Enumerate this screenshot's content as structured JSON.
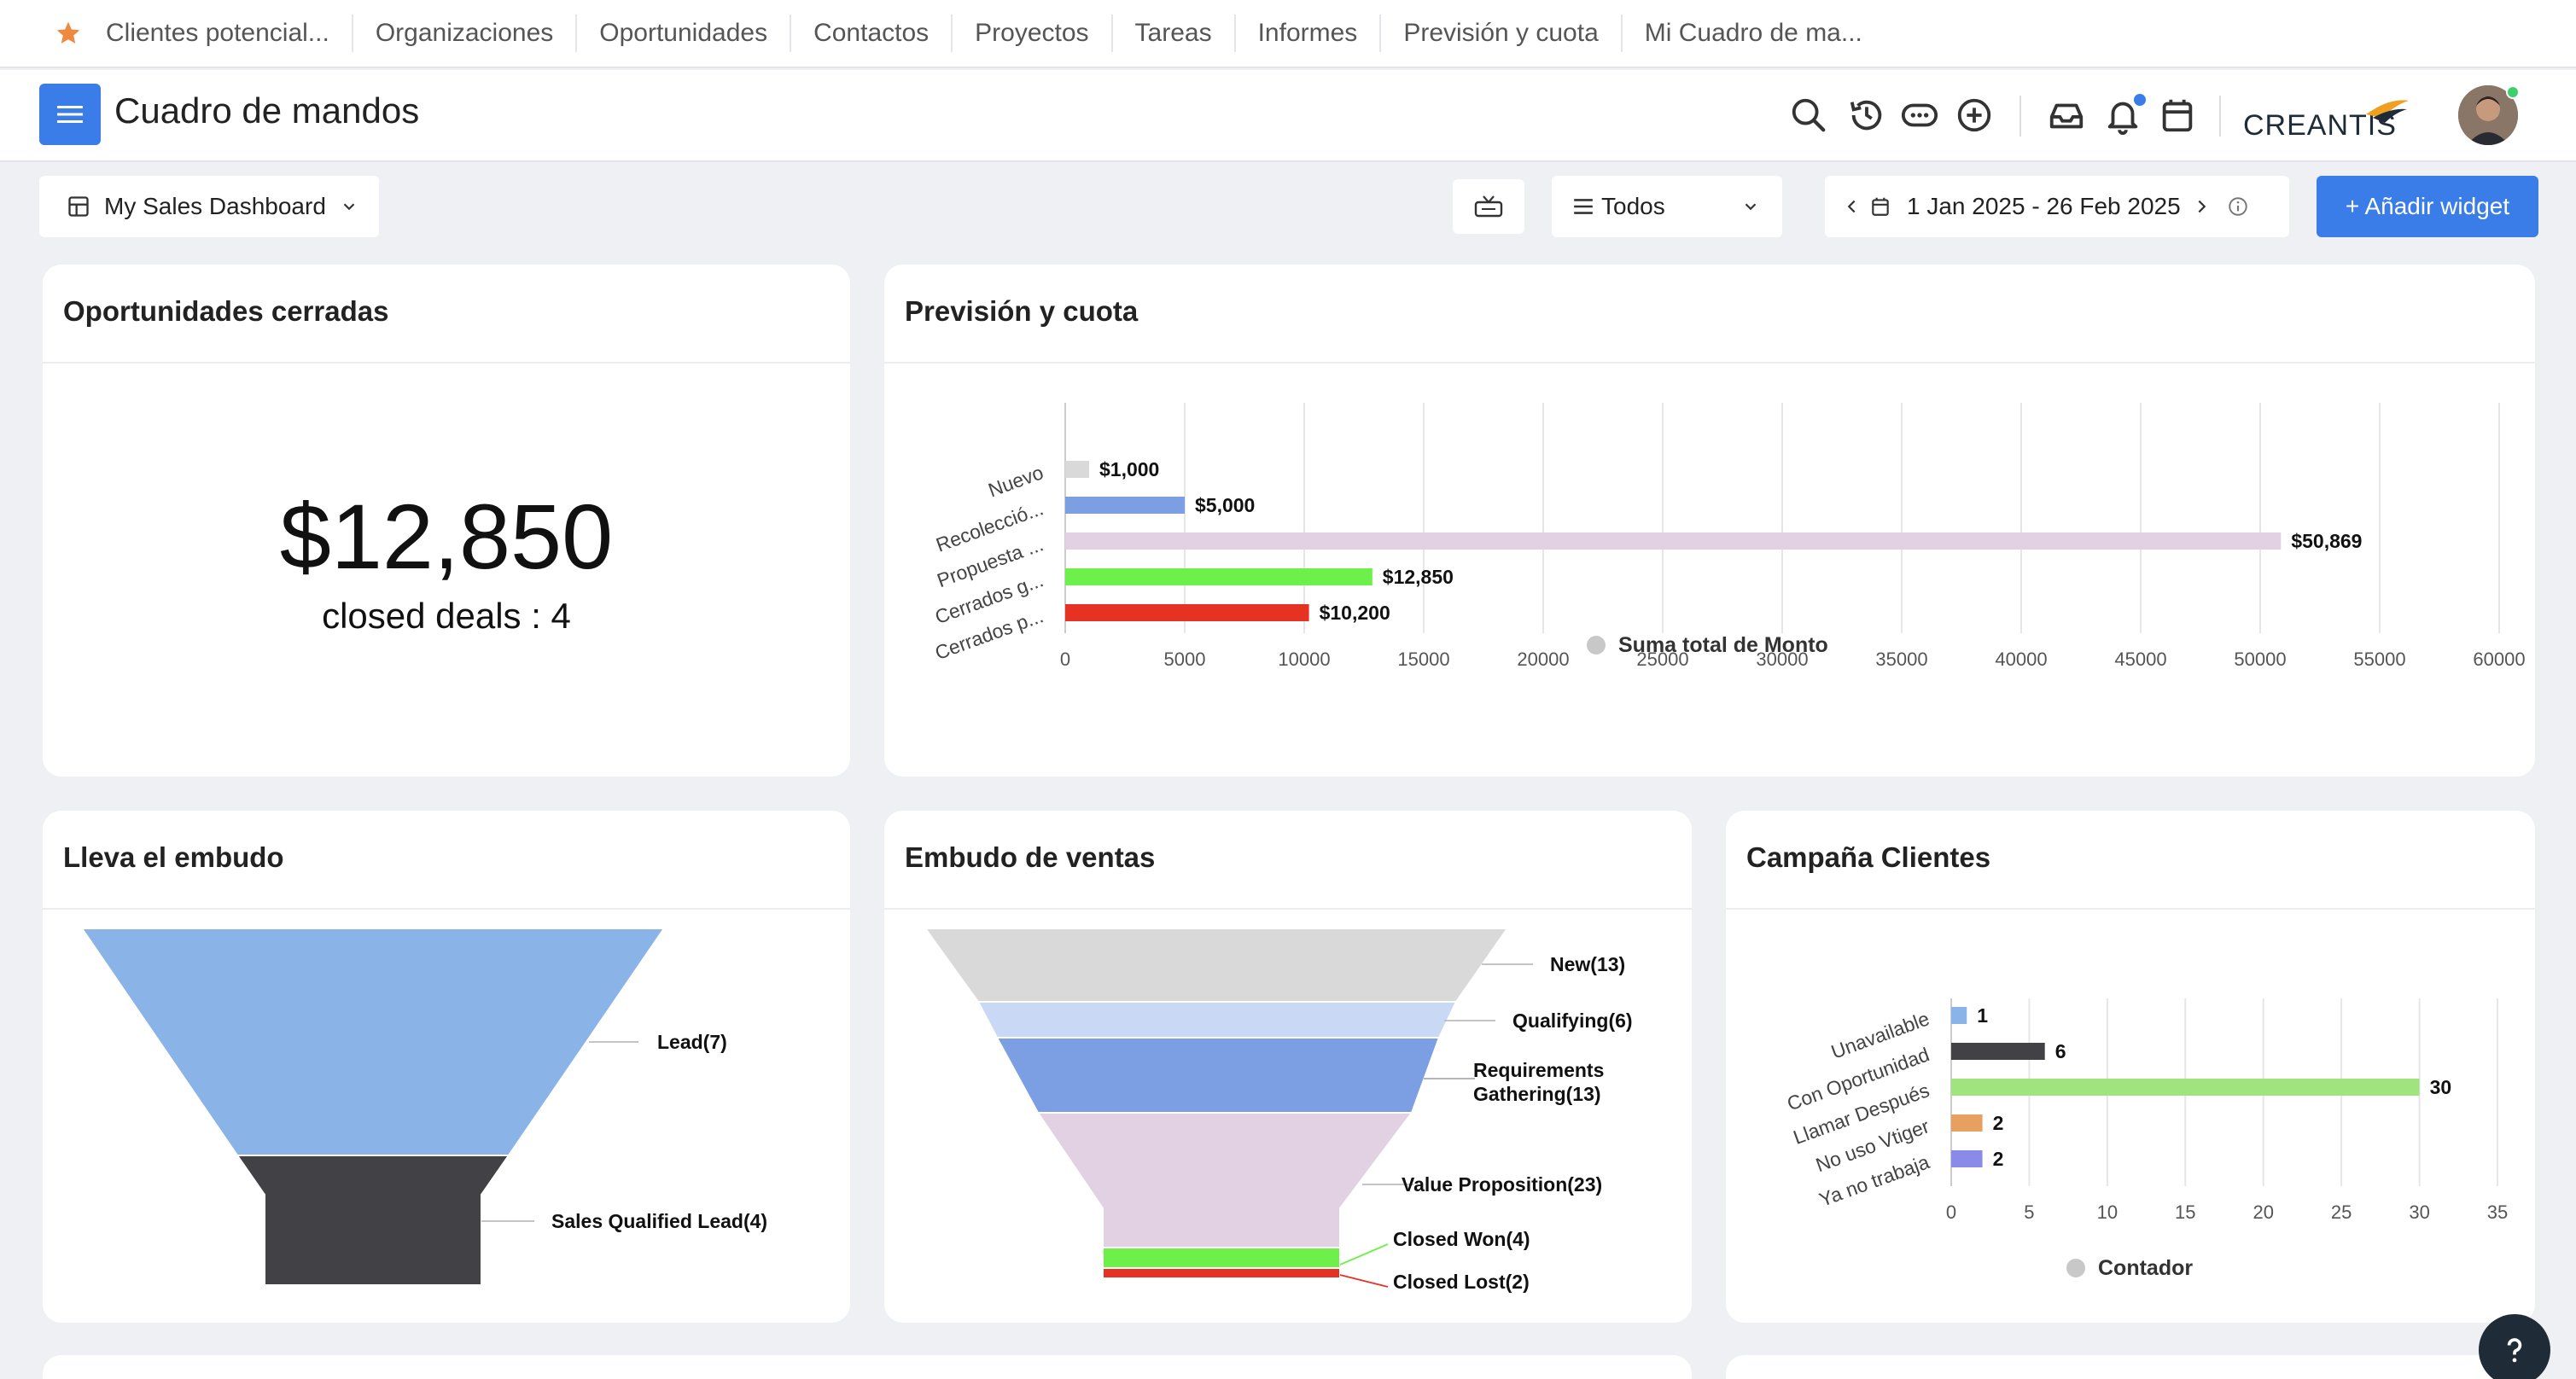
{
  "nav": {
    "tabs": [
      "Clientes potencial...",
      "Organizaciones",
      "Oportunidades",
      "Contactos",
      "Proyectos",
      "Tareas",
      "Informes",
      "Previsión y cuota",
      "Mi Cuadro de ma..."
    ]
  },
  "header": {
    "title": "Cuadro de mandos",
    "logo_text": "CREANTIS",
    "icons": [
      "search-icon",
      "history-icon",
      "chat-icon",
      "add-circle-icon",
      "inbox-icon",
      "bell-icon",
      "calendar-icon"
    ]
  },
  "toolbar": {
    "dashboard_select": "My Sales Dashboard",
    "filter_select": "Todos",
    "date_range": "1 Jan 2025 - 26 Feb 2025",
    "add_widget": "+ Añadir widget"
  },
  "widgets": {
    "closed": {
      "title": "Oportunidades cerradas",
      "value": "$12,850",
      "subtitle": "closed deals : 4"
    },
    "forecast": {
      "title": "Previsión y cuota"
    },
    "leads_funnel": {
      "title": "Lleva el embudo"
    },
    "sales_funnel": {
      "title": "Embudo de ventas"
    },
    "campaign": {
      "title": "Campaña Clientes"
    }
  },
  "colors": {
    "accent": "#3b7de8",
    "gray_bar": "#d9d9d9",
    "blue_bar": "#7b9fe2",
    "pink_bar": "#e2d1e2",
    "green_bar": "#6ef04a",
    "red_bar": "#e53222"
  },
  "chart_data": [
    {
      "type": "bar",
      "orientation": "horizontal",
      "categories": [
        "Nuevo",
        "Recolecció...",
        "Propuesta ...",
        "Cerrados g...",
        "Cerrados p..."
      ],
      "series": [
        {
          "name": "Suma total de Monto",
          "values": [
            1000,
            5000,
            50869,
            12850,
            10200
          ]
        }
      ],
      "data_labels": [
        "$1,000",
        "$5,000",
        "$50,869",
        "$12,850",
        "$10,200"
      ],
      "bar_colors": [
        "#d9d9d9",
        "#7b9fe2",
        "#e2d1e2",
        "#6ef04a",
        "#e53222"
      ],
      "x_ticks": [
        "0",
        "5000",
        "10000",
        "15000",
        "20000",
        "25000",
        "30000",
        "35000",
        "40000",
        "45000",
        "50000",
        "55000",
        "60000"
      ],
      "xlim": [
        0,
        60000
      ],
      "legend": "bottom",
      "grid": true
    },
    {
      "type": "funnel",
      "stages": [
        {
          "label": "Lead(7)",
          "value": 7,
          "color": "#8ab4e8"
        },
        {
          "label": "Sales Qualified Lead(4)",
          "value": 4,
          "color": "#424246"
        }
      ]
    },
    {
      "type": "funnel",
      "stages": [
        {
          "label": "New(13)",
          "value": 13,
          "color": "#d9d9d9"
        },
        {
          "label": "Qualifying(6)",
          "value": 6,
          "color": "#c9d9f5"
        },
        {
          "label": "Requirements",
          "label2": "Gathering(13)",
          "value": 13,
          "color": "#7b9fe2"
        },
        {
          "label": "Value Proposition(23)",
          "value": 23,
          "color": "#e2d1e2"
        },
        {
          "label": "Closed Won(4)",
          "value": 4,
          "color": "#6ef04a"
        },
        {
          "label": "Closed Lost(2)",
          "value": 2,
          "color": "#e53222"
        }
      ]
    },
    {
      "type": "bar",
      "orientation": "horizontal",
      "categories": [
        "Unavailable",
        "Con Oportunidad",
        "Llamar Después",
        "No uso Vtiger",
        "Ya no trabaja"
      ],
      "series": [
        {
          "name": "Contador",
          "values": [
            1,
            6,
            30,
            2,
            2
          ]
        }
      ],
      "data_labels": [
        "1",
        "6",
        "30",
        "2",
        "2"
      ],
      "bar_colors": [
        "#8ab4e8",
        "#424246",
        "#9fe47f",
        "#e8a060",
        "#8a8ae8"
      ],
      "x_ticks": [
        "0",
        "5",
        "10",
        "15",
        "20",
        "25",
        "30",
        "35"
      ],
      "xlim": [
        0,
        35
      ],
      "legend": "bottom",
      "grid": true
    }
  ]
}
